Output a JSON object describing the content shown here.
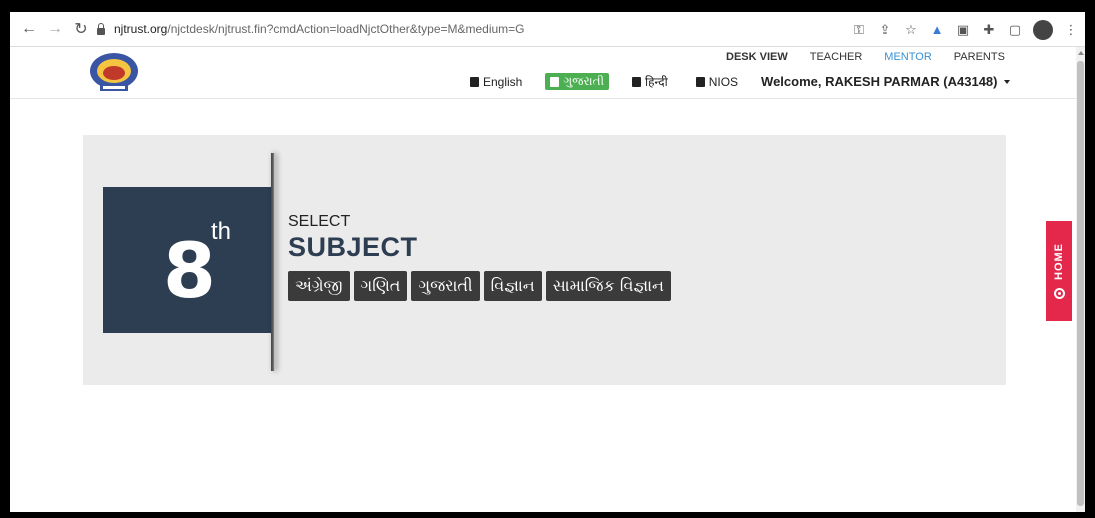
{
  "browser": {
    "url_host": "njtrust.org",
    "url_path": "/njctdesk/njtrust.fin?cmdAction=loadNjctOther&type=M&medium=G",
    "icons": [
      "key-icon",
      "share-icon",
      "star-icon",
      "extension-icon-1",
      "extension-icon-2",
      "puzzle-icon",
      "sidepanel-icon",
      "profile-icon",
      "menu-icon"
    ]
  },
  "header": {
    "roles": [
      "DESK VIEW",
      "TEACHER",
      "MENTOR",
      "PARENTS"
    ],
    "active_role": "MENTOR",
    "languages": [
      {
        "label": "English",
        "active": false
      },
      {
        "label": "ગુજરાતી",
        "active": true
      },
      {
        "label": "हिन्दी",
        "active": false
      },
      {
        "label": "NIOS",
        "active": false
      }
    ],
    "welcome": "Welcome, RAKESH PARMAR (A43148)"
  },
  "main": {
    "grade_number": "8",
    "grade_suffix": "th",
    "select_label": "SELECT",
    "subject_title": "SUBJECT",
    "subjects": [
      "અંગ્રેજી",
      "ગણિત",
      "ગુજરાતી",
      "વિજ્ઞાન",
      "સામાજિક વિજ્ઞાન"
    ]
  },
  "side_tab": {
    "label": "HOME"
  },
  "colors": {
    "grade_box": "#2e3e52",
    "active_language": "#4cb052",
    "home_tab": "#e3284b",
    "mentor_link": "#3a8fd1",
    "subject_button": "#3b3b3b"
  }
}
